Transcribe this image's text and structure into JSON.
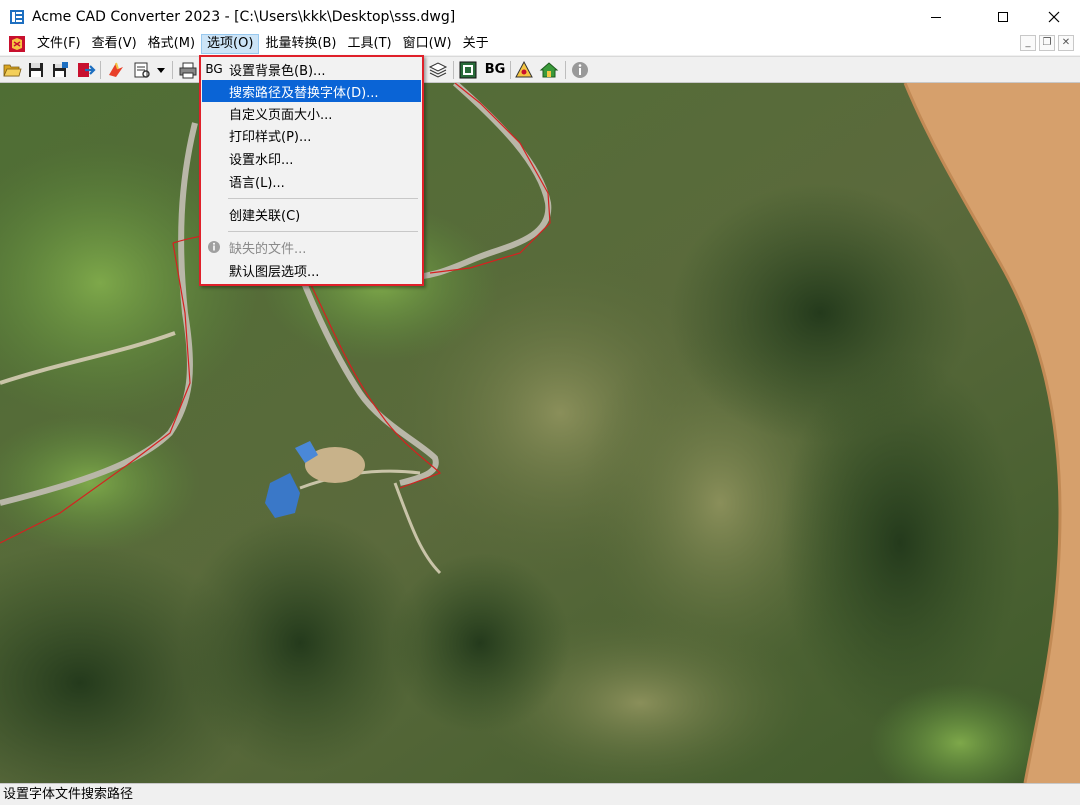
{
  "window": {
    "title": "Acme CAD Converter 2023 - [C:\\Users\\kkk\\Desktop\\sss.dwg]"
  },
  "menubar": {
    "items": [
      {
        "label": "文件(F)"
      },
      {
        "label": "查看(V)"
      },
      {
        "label": "格式(M)"
      },
      {
        "label": "选项(O)",
        "active": true
      },
      {
        "label": "批量转换(B)"
      },
      {
        "label": "工具(T)"
      },
      {
        "label": "窗口(W)"
      },
      {
        "label": "关于"
      }
    ]
  },
  "toolbar": {
    "bg_label": "BG",
    "icons": [
      "open-folder-icon",
      "save-icon",
      "save-as-icon",
      "export-icon",
      "convert-icon",
      "print-preview-icon",
      "dropdown-arrow-icon",
      "printer-icon",
      "layers-icon",
      "frame-icon",
      "bg-icon",
      "warning-icon",
      "home-icon",
      "info-icon"
    ]
  },
  "dropdown": {
    "items": [
      {
        "icon_text": "BG",
        "label": "设置背景色(B)..."
      },
      {
        "label": "搜索路径及替换字体(D)...",
        "highlighted": true
      },
      {
        "label": "自定义页面大小..."
      },
      {
        "label": "打印样式(P)..."
      },
      {
        "label": "设置水印..."
      },
      {
        "label": "语言(L)..."
      },
      {
        "label": "创建关联(C)"
      },
      {
        "label": "缺失的文件...",
        "disabled": true,
        "icon": "info-icon"
      },
      {
        "label": "默认图层选项..."
      }
    ]
  },
  "statusbar": {
    "text": "设置字体文件搜索路径"
  },
  "colors": {
    "highlight": "#0a64d6",
    "menu_active": "#cce4f7",
    "annotation_border": "#e0202a",
    "cad_line": "#d62020"
  }
}
